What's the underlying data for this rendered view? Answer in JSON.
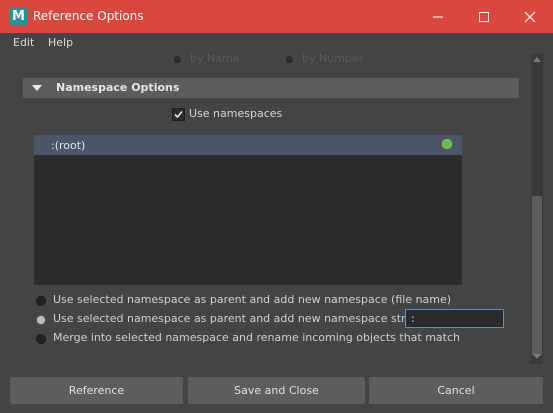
{
  "window": {
    "app_icon_letter": "M",
    "title": "Reference Options",
    "controls": [
      "minimize-icon",
      "maximize-icon",
      "close-icon"
    ]
  },
  "menu": [
    {
      "label": "Edit"
    },
    {
      "label": "Help"
    }
  ],
  "partial_options": {
    "radio_1": "by Name",
    "radio_2": "by Number"
  },
  "namespace_section": {
    "title": "Namespace Options",
    "expanded": true,
    "use_namespaces": {
      "label": "Use namespaces",
      "checked": true
    },
    "namespace_list": {
      "items": [
        {
          "label": ":(root)",
          "selected": true,
          "status_color": "#5fbf3a"
        }
      ]
    },
    "modes": [
      {
        "label": "Use selected namespace as parent and add new namespace (file name)",
        "selected": false
      },
      {
        "label": "Use selected namespace as parent and add new namespace string:",
        "selected": true
      },
      {
        "label": "Merge into selected namespace and rename incoming objects that match",
        "selected": false
      }
    ],
    "namespace_string": {
      "value": ":"
    }
  },
  "buttons": {
    "reference": "Reference",
    "save_close": "Save and Close",
    "cancel": "Cancel"
  },
  "colors": {
    "titlebar": "#d9473e",
    "background": "#444444",
    "list_background": "#2b2b2b",
    "selection": "#4a5566",
    "input_focus": "#5a8fc4"
  }
}
